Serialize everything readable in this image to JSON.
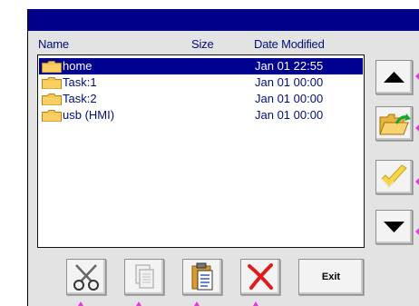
{
  "file_list": {
    "columns": {
      "name": "Name",
      "size": "Size",
      "date": "Date Modified"
    },
    "rows": [
      {
        "name": "home",
        "size": "",
        "date": "Jan 01 22:55",
        "selected": true
      },
      {
        "name": "Task:1",
        "size": "",
        "date": "Jan 01 00:00",
        "selected": false
      },
      {
        "name": "Task:2",
        "size": "",
        "date": "Jan 01 00:00",
        "selected": false
      },
      {
        "name": "usb (HMI)",
        "size": "",
        "date": "Jan 01 00:00",
        "selected": false
      }
    ]
  },
  "side_buttons": [
    {
      "icon": "arrow-up-icon"
    },
    {
      "icon": "open-folder-icon"
    },
    {
      "icon": "checkmark-icon"
    },
    {
      "icon": "arrow-down-icon"
    }
  ],
  "bottom_buttons": [
    {
      "icon": "scissors-icon"
    },
    {
      "icon": "copy-icon"
    },
    {
      "icon": "paste-icon"
    },
    {
      "icon": "delete-x-icon"
    }
  ],
  "exit_label": "Exit",
  "colors": {
    "titlebar": "#00008b",
    "selection": "#000090",
    "text": "#000d7a",
    "marker": "#e03ce0"
  }
}
